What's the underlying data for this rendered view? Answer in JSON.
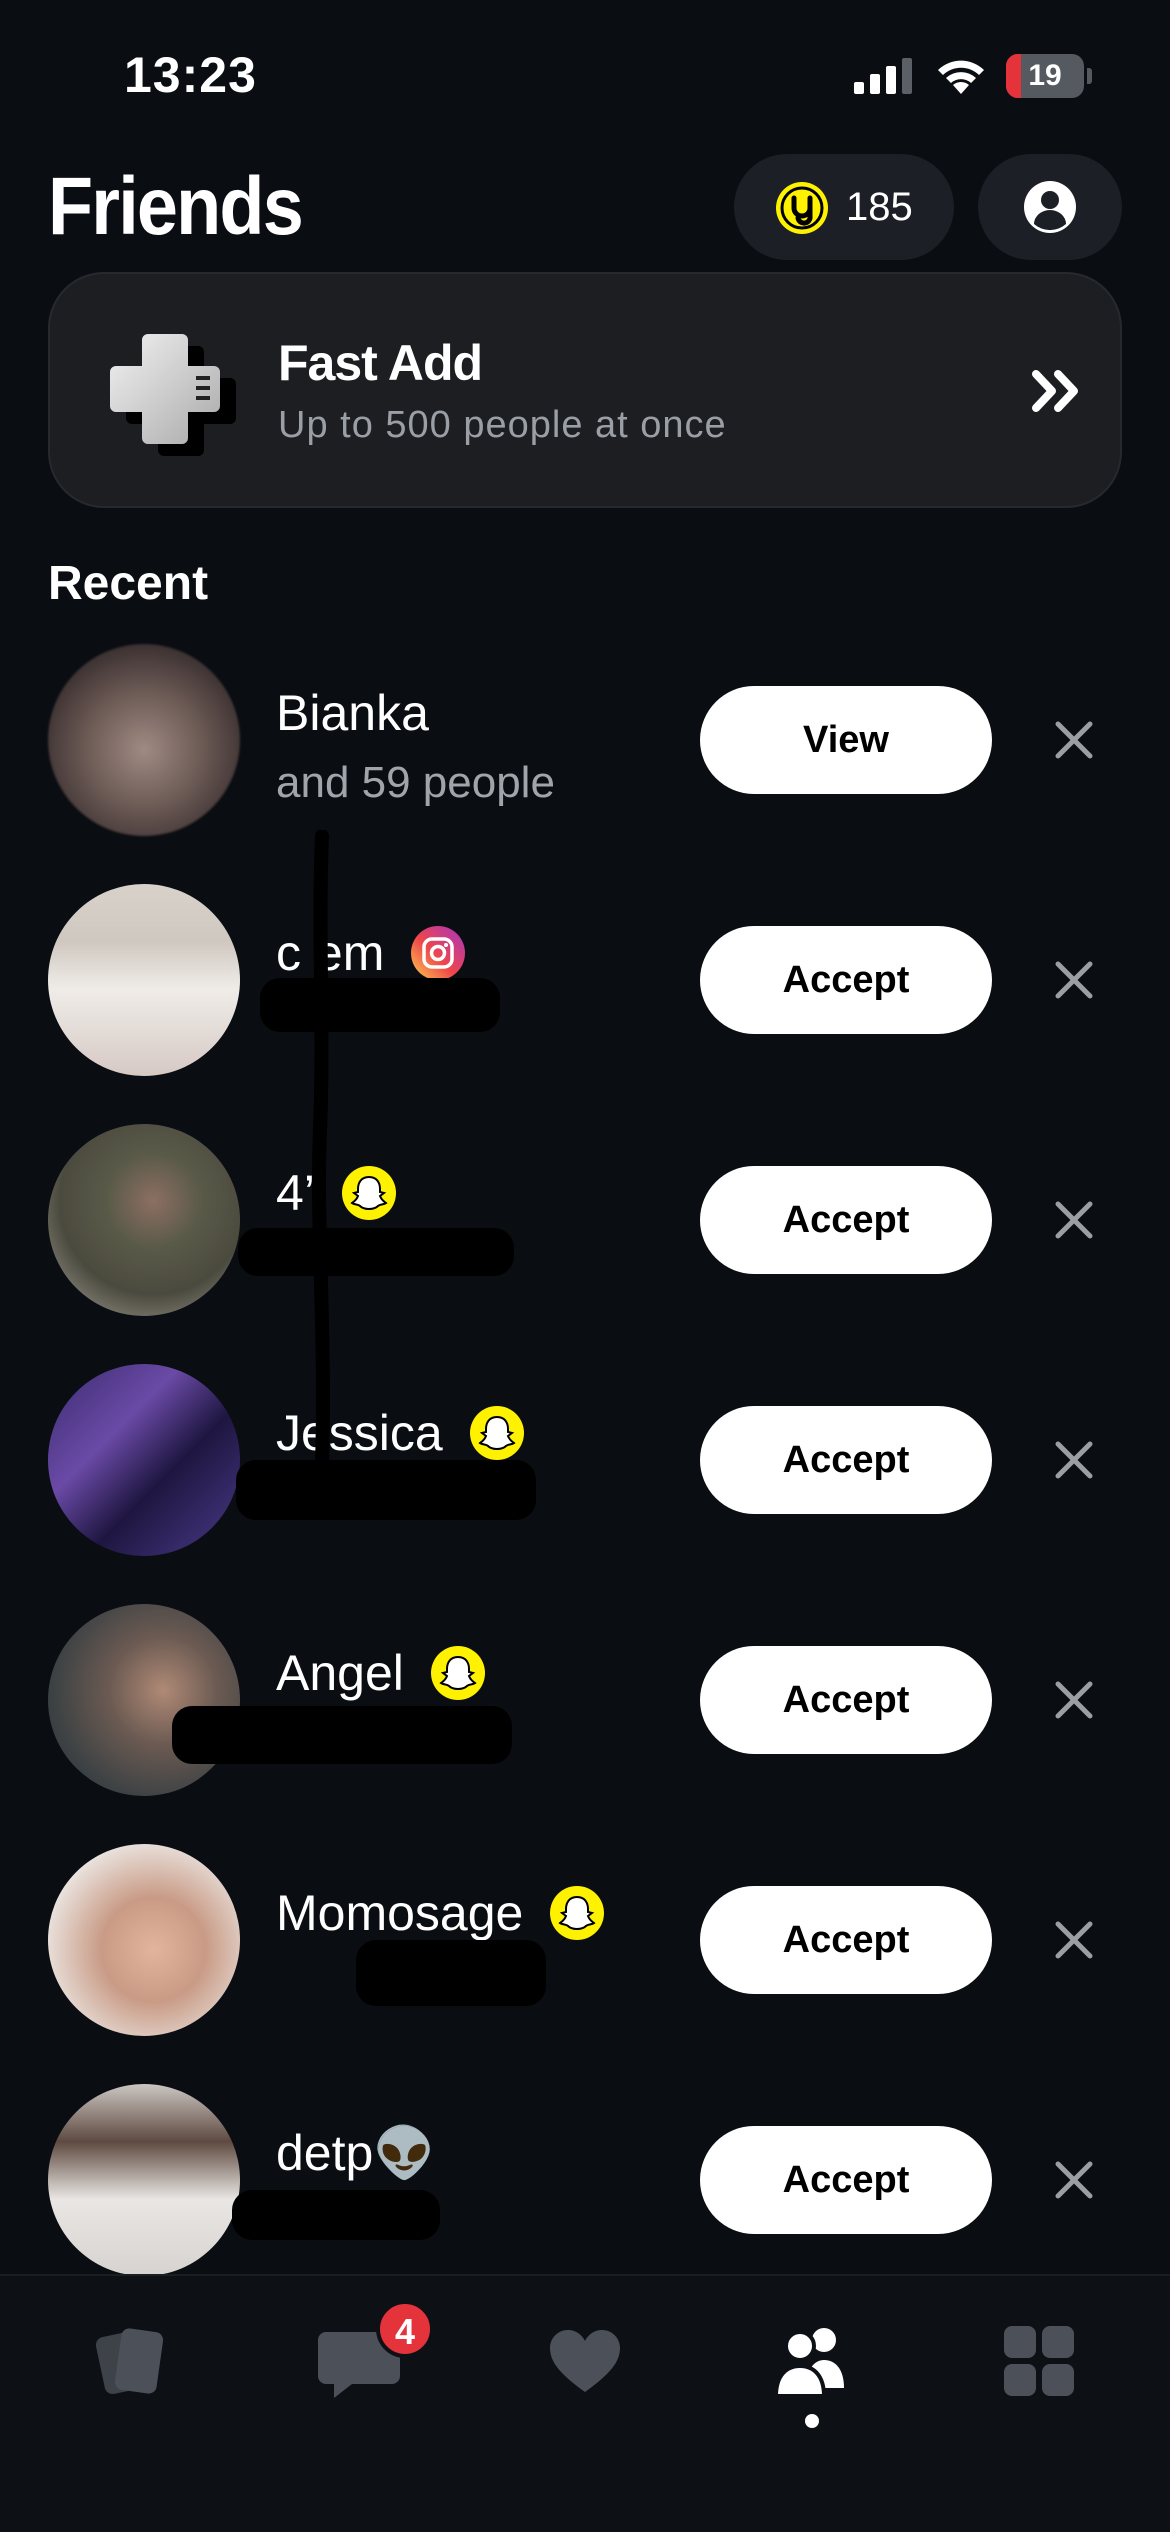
{
  "status_bar": {
    "time": "13:23",
    "battery": "19",
    "battery_level": 0.19
  },
  "header": {
    "title": "Friends",
    "coins": "185"
  },
  "fast_add": {
    "title": "Fast Add",
    "subtitle": "Up to 500 people at once"
  },
  "section": {
    "title": "Recent"
  },
  "requests": [
    {
      "name": "Bianka",
      "subtitle": "and 59 people",
      "action": "View",
      "source": ""
    },
    {
      "name": "c  em",
      "subtitle": "",
      "action": "Accept",
      "source": "instagram"
    },
    {
      "name": "4’",
      "subtitle": "",
      "action": "Accept",
      "source": "snapchat"
    },
    {
      "name": "Jessica",
      "subtitle": "",
      "action": "Accept",
      "source": "snapchat"
    },
    {
      "name": "Angel",
      "subtitle": "",
      "action": "Accept",
      "source": "snapchat"
    },
    {
      "name": "Momosage",
      "subtitle": "",
      "action": "Accept",
      "source": "snapchat"
    },
    {
      "name": "detp👽",
      "subtitle": "",
      "action": "Accept",
      "source": ""
    }
  ],
  "tab_bar": {
    "tabs": [
      "cards-icon",
      "chat-icon",
      "heart-icon",
      "friends-icon",
      "grid-icon"
    ],
    "chat_badge": "4",
    "active": "friends"
  },
  "colors": {
    "background": "#0a0d12",
    "accent_yellow": "#fff200",
    "badge_red": "#e5333c"
  }
}
